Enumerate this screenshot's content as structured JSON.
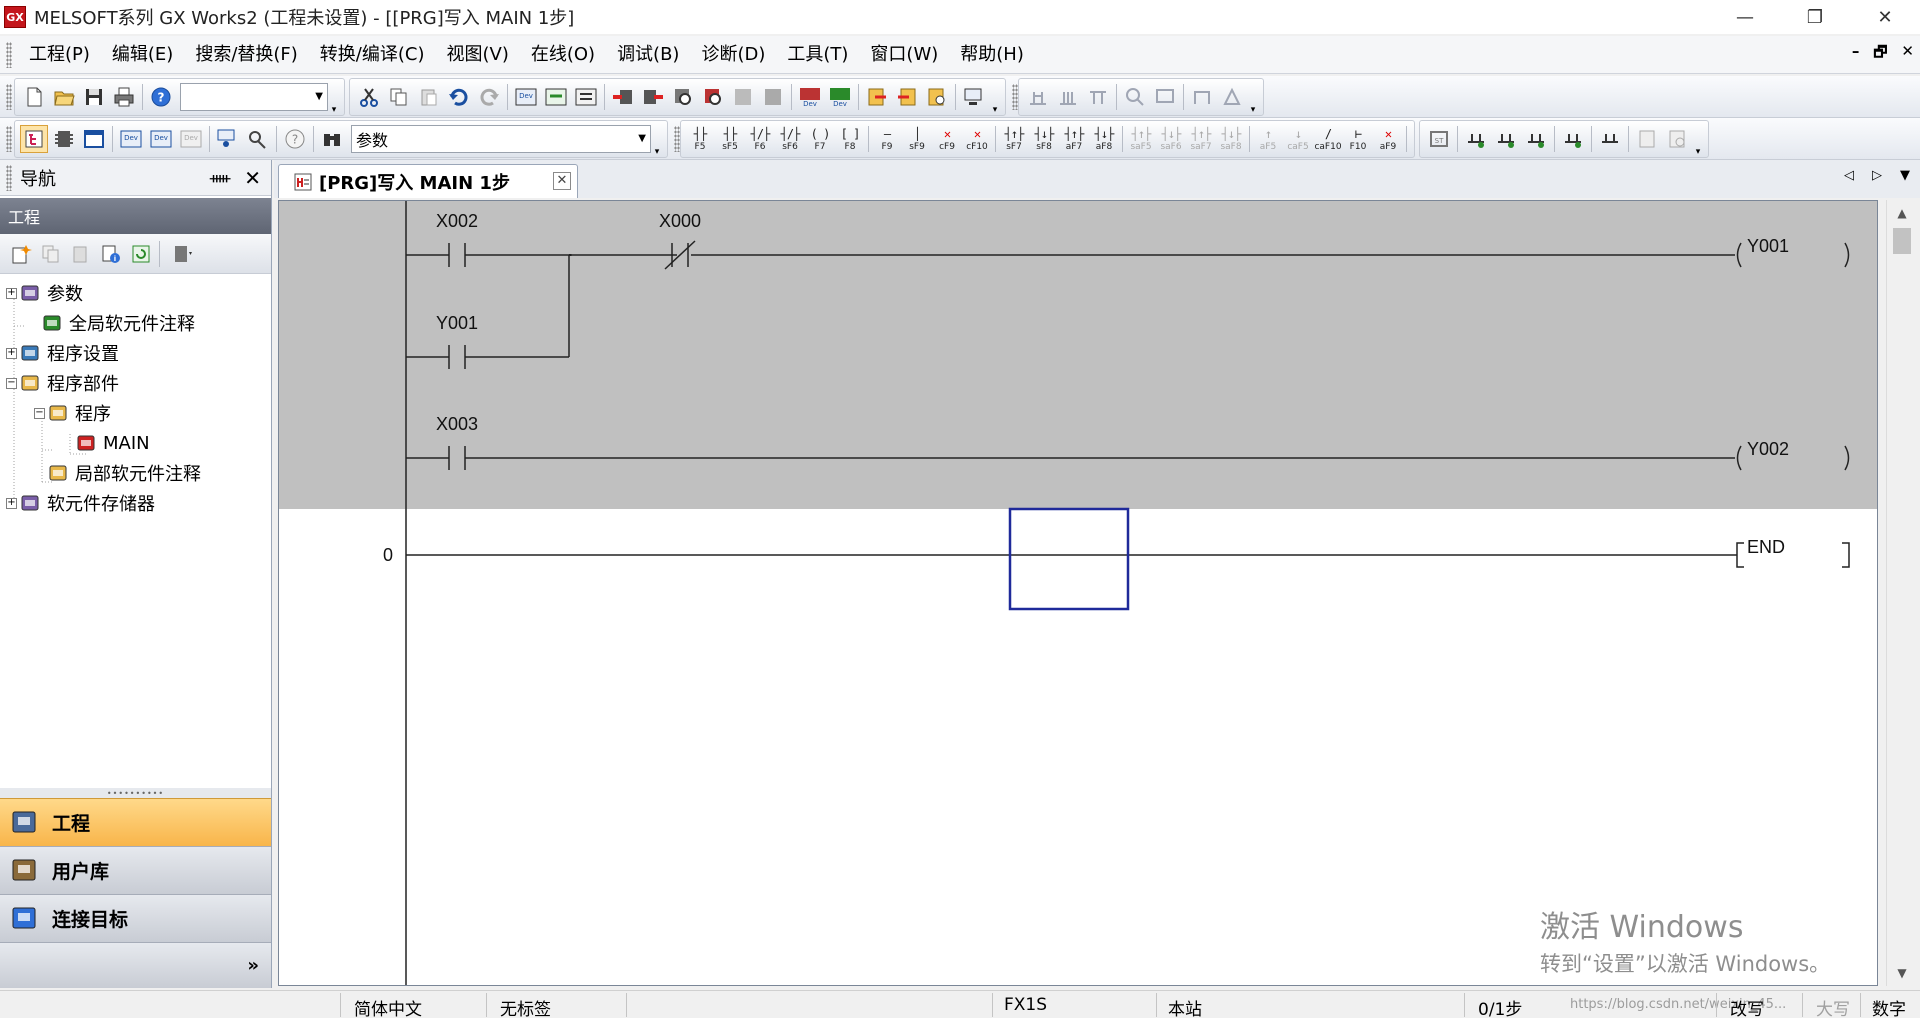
{
  "window": {
    "title": "MELSOFT系列 GX Works2 (工程未设置) - [[PRG]写入 MAIN 1步]",
    "app_icon_text": "GX",
    "minimize": "—",
    "restore": "❐",
    "close": "✕"
  },
  "menu": {
    "items": [
      "工程(P)",
      "编辑(E)",
      "搜索/替换(F)",
      "转换/编译(C)",
      "视图(V)",
      "在线(O)",
      "调试(B)",
      "诊断(D)",
      "工具(T)",
      "窗口(W)",
      "帮助(H)"
    ],
    "mdi_minimize": "–",
    "mdi_restore": "🗗",
    "mdi_close": "✕"
  },
  "toolbar": {
    "combo1_value": "",
    "combo2_value": "参数",
    "ladder_buttons": [
      {
        "sym": "┤├",
        "key": "F5",
        "icon": "open-contact-icon"
      },
      {
        "sym": "┤├",
        "key": "sF5",
        "icon": "parallel-open-contact-icon"
      },
      {
        "sym": "┤/├",
        "key": "F6",
        "icon": "closed-contact-icon"
      },
      {
        "sym": "┤/├",
        "key": "sF6",
        "icon": "parallel-closed-contact-icon"
      },
      {
        "sym": "( )",
        "key": "F7",
        "icon": "coil-icon"
      },
      {
        "sym": "[ ]",
        "key": "F8",
        "icon": "instruction-icon"
      },
      {
        "sym": "—",
        "key": "F9",
        "icon": "horizontal-line-icon"
      },
      {
        "sym": "│",
        "key": "sF9",
        "icon": "vertical-line-icon"
      },
      {
        "sym": "✕",
        "key": "cF9",
        "icon": "delete-horizontal-line-icon"
      },
      {
        "sym": "✕",
        "key": "cF10",
        "icon": "delete-vertical-line-icon"
      },
      {
        "sym": "┤↑├",
        "key": "sF7",
        "icon": "rising-pulse-icon"
      },
      {
        "sym": "┤↓├",
        "key": "sF8",
        "icon": "falling-pulse-icon"
      },
      {
        "sym": "┤↑├",
        "key": "aF7",
        "icon": "parallel-rising-pulse-icon"
      },
      {
        "sym": "┤↓├",
        "key": "aF8",
        "icon": "parallel-falling-pulse-icon"
      },
      {
        "sym": "┤↑├",
        "key": "saF5",
        "icon": "rising-pulse-closed-icon"
      },
      {
        "sym": "┤↓├",
        "key": "saF6",
        "icon": "falling-pulse-closed-icon"
      },
      {
        "sym": "┤↑├",
        "key": "saF7",
        "icon": "parallel-rising-closed-icon"
      },
      {
        "sym": "┤↓├",
        "key": "saF8",
        "icon": "parallel-falling-closed-icon"
      },
      {
        "sym": "↑",
        "key": "aF5",
        "icon": "operation-result-rising-icon"
      },
      {
        "sym": "↓",
        "key": "caF5",
        "icon": "operation-result-falling-icon"
      },
      {
        "sym": "/",
        "key": "caF10",
        "icon": "invert-result-icon"
      },
      {
        "sym": "⊢",
        "key": "F10",
        "icon": "draw-line-icon"
      },
      {
        "sym": "✕",
        "key": "aF9",
        "icon": "delete-line-icon"
      }
    ]
  },
  "navigation": {
    "header": "导航",
    "pin": "ᚔ",
    "close": "✕",
    "section_title": "工程",
    "tree": [
      {
        "label": "参数",
        "expander": "+",
        "icon": "parameter-icon"
      },
      {
        "label": "全局软元件注释",
        "expander": "",
        "icon": "global-comment-icon"
      },
      {
        "label": "程序设置",
        "expander": "+",
        "icon": "program-setting-icon"
      },
      {
        "label": "程序部件",
        "expander": "−",
        "icon": "program-parts-folder-icon"
      },
      {
        "label": "程序",
        "expander": "−",
        "icon": "program-folder-icon"
      },
      {
        "label": "MAIN",
        "expander": "",
        "icon": "ladder-program-icon"
      },
      {
        "label": "局部软元件注释",
        "expander": "",
        "icon": "local-comment-icon"
      },
      {
        "label": "软元件存储器",
        "expander": "+",
        "icon": "device-memory-icon"
      }
    ],
    "bottom_buttons": [
      {
        "label": "工程",
        "active": true,
        "icon": "project-icon"
      },
      {
        "label": "用户库",
        "active": false,
        "icon": "user-library-icon"
      },
      {
        "label": "连接目标",
        "active": false,
        "icon": "connection-destination-icon"
      }
    ],
    "chevron": "»"
  },
  "editor": {
    "tab_label": "[PRG]写入 MAIN 1步",
    "tab_close": "✕",
    "tab_prev": "◁",
    "tab_next": "▷",
    "tab_menu": "▼",
    "rung1_contact1": "X002",
    "rung1_contact2": "X000",
    "rung1_branch_contact": "Y001",
    "rung1_coil": "Y001",
    "rung2_contact": "X003",
    "rung2_coil": "Y002",
    "end_step": "0",
    "end_instruction": "END",
    "unconverted_bg": "#c0c0c0",
    "cursor_color": "#1f2a9a"
  },
  "os_overlay": {
    "line1": "激活 Windows",
    "line2": "转到“设置”以激活 Windows。"
  },
  "statusbar": {
    "language": "简体中文",
    "label": "无标签",
    "plc": "FX1S",
    "station": "本站",
    "steps": "0/1步",
    "mode": "改写",
    "caps": "大写",
    "num": "数字",
    "watermark": "https://blog.csdn.net/weixin_45..."
  }
}
